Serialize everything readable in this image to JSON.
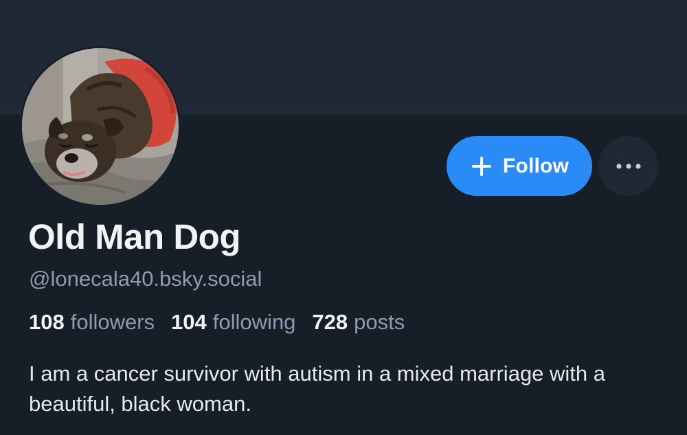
{
  "profile": {
    "display_name": "Old Man Dog",
    "handle": "@lonecala40.bsky.social",
    "avatar_alt": "avatar",
    "bio": "I am a cancer survivor with autism in a mixed marriage with a beautiful, black woman."
  },
  "stats": {
    "followers_count": "108",
    "followers_label": "followers",
    "following_count": "104",
    "following_label": "following",
    "posts_count": "728",
    "posts_label": "posts"
  },
  "actions": {
    "follow_label": "Follow",
    "follow_icon": "plus-icon",
    "more_icon": "ellipsis-icon"
  },
  "colors": {
    "background": "#161e27",
    "banner": "#1e2935",
    "accent": "#2a8af6",
    "muted_text": "#8e9bb0",
    "primary_text": "#f1f3f5"
  }
}
